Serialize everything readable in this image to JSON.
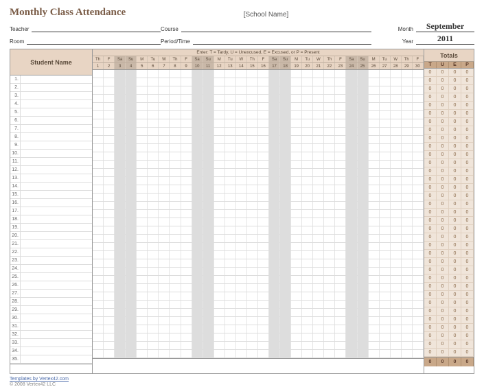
{
  "title": "Monthly Class Attendance",
  "school_placeholder": "[School Name]",
  "labels": {
    "teacher": "Teacher",
    "room": "Room",
    "course": "Course",
    "period": "Period/Time",
    "month": "Month",
    "year": "Year",
    "student_name": "Student Name",
    "totals": "Totals",
    "legend": "Enter: T = Tardy,  U = Unexcused,  E = Excused,  or P = Present"
  },
  "month": "September",
  "year": "2011",
  "days": [
    {
      "dow": "Th",
      "num": 1,
      "wknd": false
    },
    {
      "dow": "F",
      "num": 2,
      "wknd": false
    },
    {
      "dow": "Sa",
      "num": 3,
      "wknd": true
    },
    {
      "dow": "Su",
      "num": 4,
      "wknd": true
    },
    {
      "dow": "M",
      "num": 5,
      "wknd": false
    },
    {
      "dow": "Tu",
      "num": 6,
      "wknd": false
    },
    {
      "dow": "W",
      "num": 7,
      "wknd": false
    },
    {
      "dow": "Th",
      "num": 8,
      "wknd": false
    },
    {
      "dow": "F",
      "num": 9,
      "wknd": false
    },
    {
      "dow": "Sa",
      "num": 10,
      "wknd": true
    },
    {
      "dow": "Su",
      "num": 11,
      "wknd": true
    },
    {
      "dow": "M",
      "num": 12,
      "wknd": false
    },
    {
      "dow": "Tu",
      "num": 13,
      "wknd": false
    },
    {
      "dow": "W",
      "num": 14,
      "wknd": false
    },
    {
      "dow": "Th",
      "num": 15,
      "wknd": false
    },
    {
      "dow": "F",
      "num": 16,
      "wknd": false
    },
    {
      "dow": "Sa",
      "num": 17,
      "wknd": true
    },
    {
      "dow": "Su",
      "num": 18,
      "wknd": true
    },
    {
      "dow": "M",
      "num": 19,
      "wknd": false
    },
    {
      "dow": "Tu",
      "num": 20,
      "wknd": false
    },
    {
      "dow": "W",
      "num": 21,
      "wknd": false
    },
    {
      "dow": "Th",
      "num": 22,
      "wknd": false
    },
    {
      "dow": "F",
      "num": 23,
      "wknd": false
    },
    {
      "dow": "Sa",
      "num": 24,
      "wknd": true
    },
    {
      "dow": "Su",
      "num": 25,
      "wknd": true
    },
    {
      "dow": "M",
      "num": 26,
      "wknd": false
    },
    {
      "dow": "Tu",
      "num": 27,
      "wknd": false
    },
    {
      "dow": "W",
      "num": 28,
      "wknd": false
    },
    {
      "dow": "Th",
      "num": 29,
      "wknd": false
    },
    {
      "dow": "F",
      "num": 30,
      "wknd": false
    }
  ],
  "total_cols": [
    "T",
    "U",
    "E",
    "P"
  ],
  "rows": 35,
  "default_total": "0",
  "footer_totals": [
    "0",
    "0",
    "0",
    "0"
  ],
  "footer": {
    "link_text": "Templates by Vertex42.com",
    "copyright": "© 2008 Vertex42 LLC"
  }
}
